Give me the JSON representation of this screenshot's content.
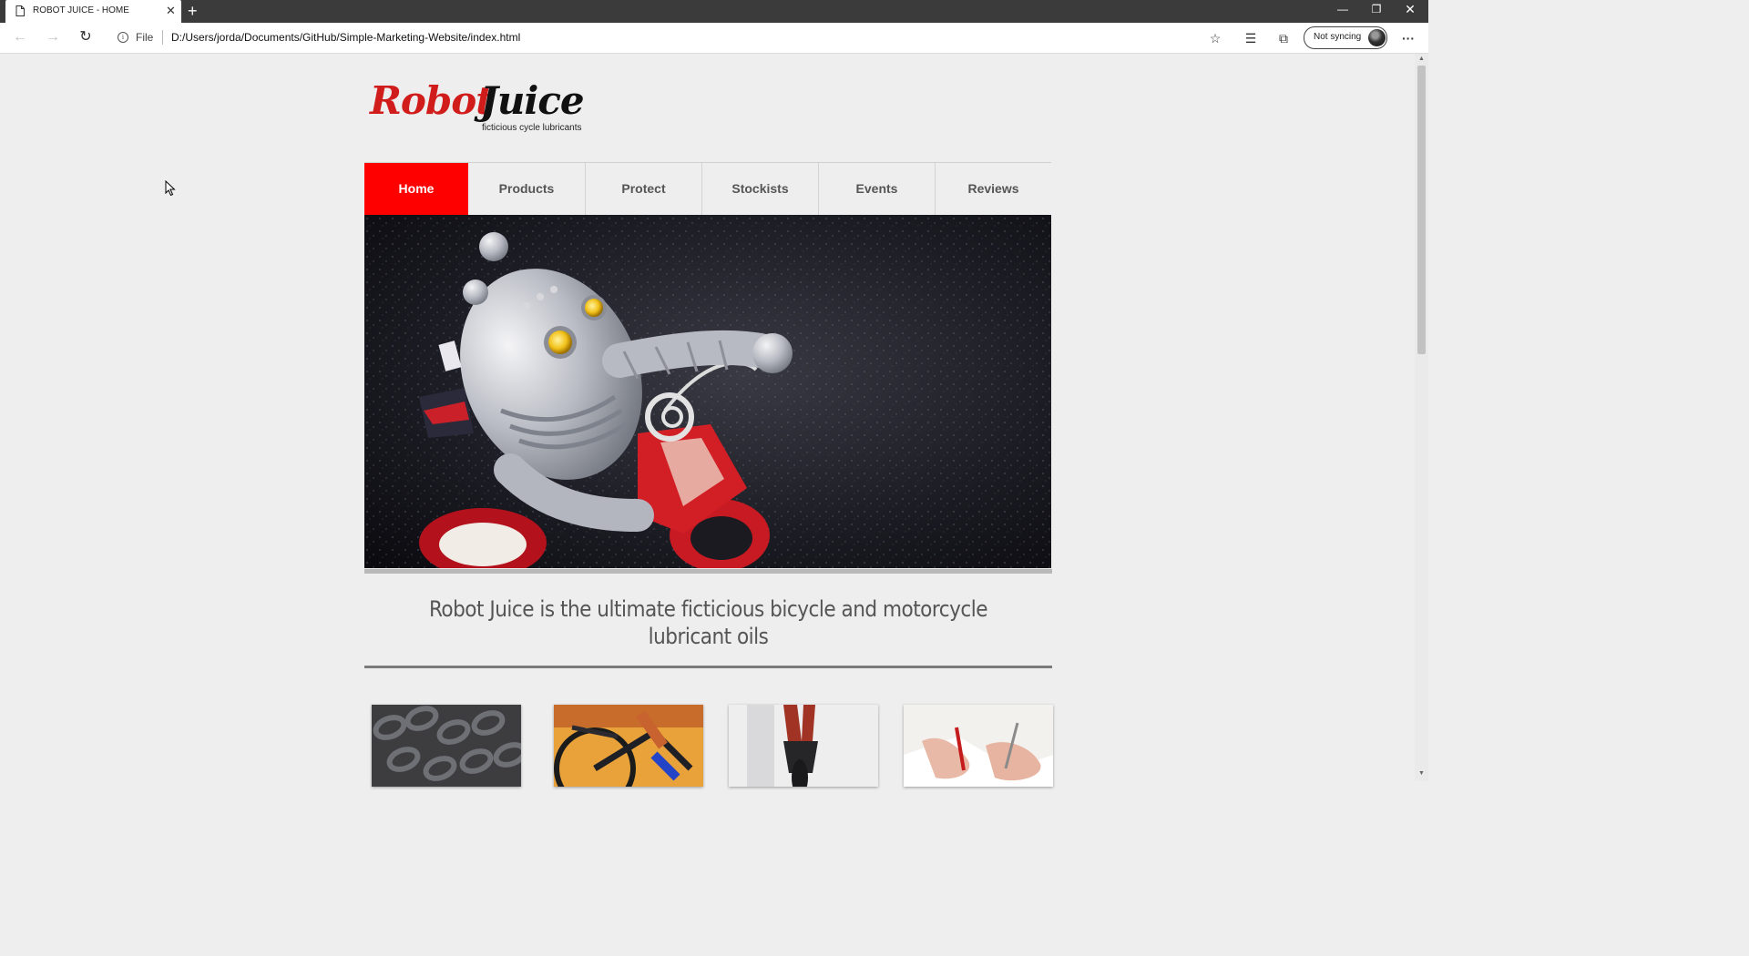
{
  "browser": {
    "tab_title": "ROBOT JUICE - HOME",
    "file_label": "File",
    "url": "D:/Users/jorda/Documents/GitHub/Simple-Marketing-Website/index.html",
    "sync_label": "Not syncing"
  },
  "site": {
    "logo_word1": "Robot",
    "logo_word2": "Juice",
    "logo_tagline": "ficticious cycle lubricants",
    "brand_color": "#ff0000",
    "nav": [
      {
        "label": "Home",
        "active": true
      },
      {
        "label": "Products",
        "active": false
      },
      {
        "label": "Protect",
        "active": false
      },
      {
        "label": "Stockists",
        "active": false
      },
      {
        "label": "Events",
        "active": false
      },
      {
        "label": "Reviews",
        "active": false
      }
    ],
    "tagline": "Robot Juice is the ultimate ficticious bicycle and motorcycle lubricant oils"
  }
}
